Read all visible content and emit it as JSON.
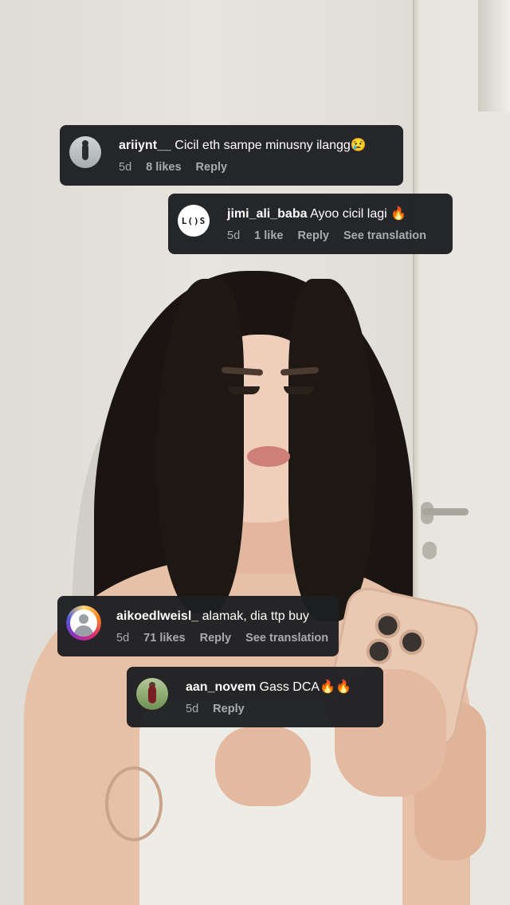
{
  "comments": [
    {
      "username": "ariiynt__",
      "text": "Cicil eth sampe minusny ilangg😢",
      "time": "5d",
      "likes": "8 likes",
      "reply": "Reply",
      "translation": "",
      "avatar": "photo-avatar"
    },
    {
      "username": "jimi_ali_baba",
      "text": "Ayoo cicil lagi 🔥",
      "time": "5d",
      "likes": "1 like",
      "reply": "Reply",
      "translation": "See translation",
      "avatar": "logo-avatar",
      "avatar_text": "L()S"
    },
    {
      "username": "aikoedlweisl_",
      "text": "alamak, dia ttp buy",
      "time": "5d",
      "likes": "71 likes",
      "reply": "Reply",
      "translation": "See translation",
      "avatar": "default-person-avatar"
    },
    {
      "username": "aan_novem",
      "text": "Gass DCA🔥🔥",
      "time": "5d",
      "likes": "",
      "reply": "Reply",
      "translation": "",
      "avatar": "photo-avatar"
    }
  ],
  "colors": {
    "bubble_bg": "#1d1e21",
    "meta_text": "#a9abb1",
    "text": "#ffffff"
  }
}
